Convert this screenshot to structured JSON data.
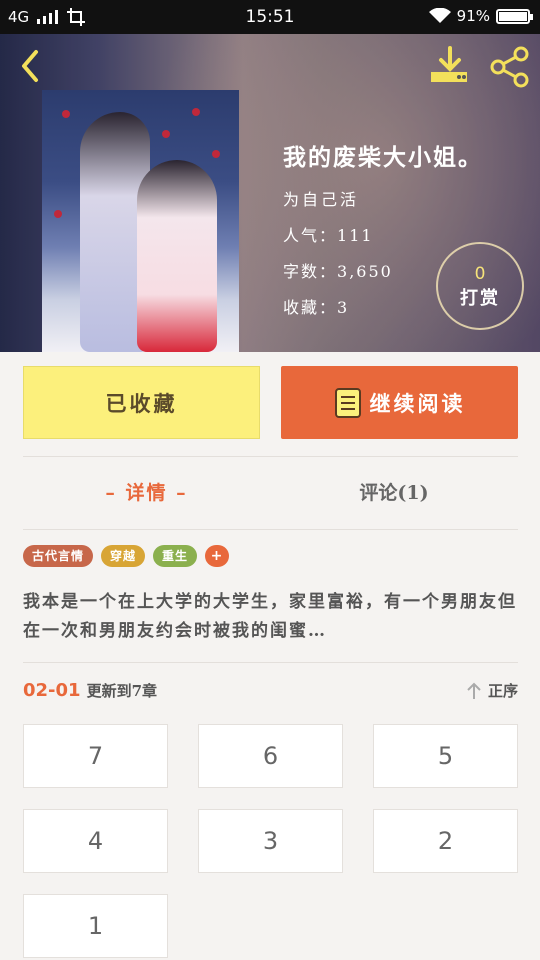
{
  "status_bar": {
    "network": "4G",
    "time": "15:51",
    "battery": "91%"
  },
  "book": {
    "title": "我的废柴大小姐。",
    "author": "为自己活",
    "popularity_label": "人气：",
    "popularity_value": "111",
    "words_label": "字数：",
    "words_value": "3,650",
    "favorites_label": "收藏：",
    "favorites_value": "3"
  },
  "reward": {
    "count": "0",
    "label": "打赏"
  },
  "actions": {
    "favorited_label": "已收藏",
    "continue_label": "继续阅读"
  },
  "tabs": {
    "detail_label": "– 详情 –",
    "comments_label": "评论(1)"
  },
  "tags": [
    {
      "label": "古代言情",
      "color": "#c7674a"
    },
    {
      "label": "穿越",
      "color": "#d8a535"
    },
    {
      "label": "重生",
      "color": "#8bb04e"
    },
    {
      "label": "+",
      "color": "#e8683b"
    }
  ],
  "summary": "我本是一个在上大学的大学生，家里富裕，有一个男朋友但在一次和男朋友约会时被我的闺蜜…",
  "update": {
    "date": "02-01",
    "text": "更新到7章",
    "sort_label": "正序"
  },
  "chapters": [
    "7",
    "6",
    "5",
    "4",
    "3",
    "2",
    "1"
  ],
  "colors": {
    "accent": "#e8683b",
    "favorite_button": "#fcf07c"
  }
}
